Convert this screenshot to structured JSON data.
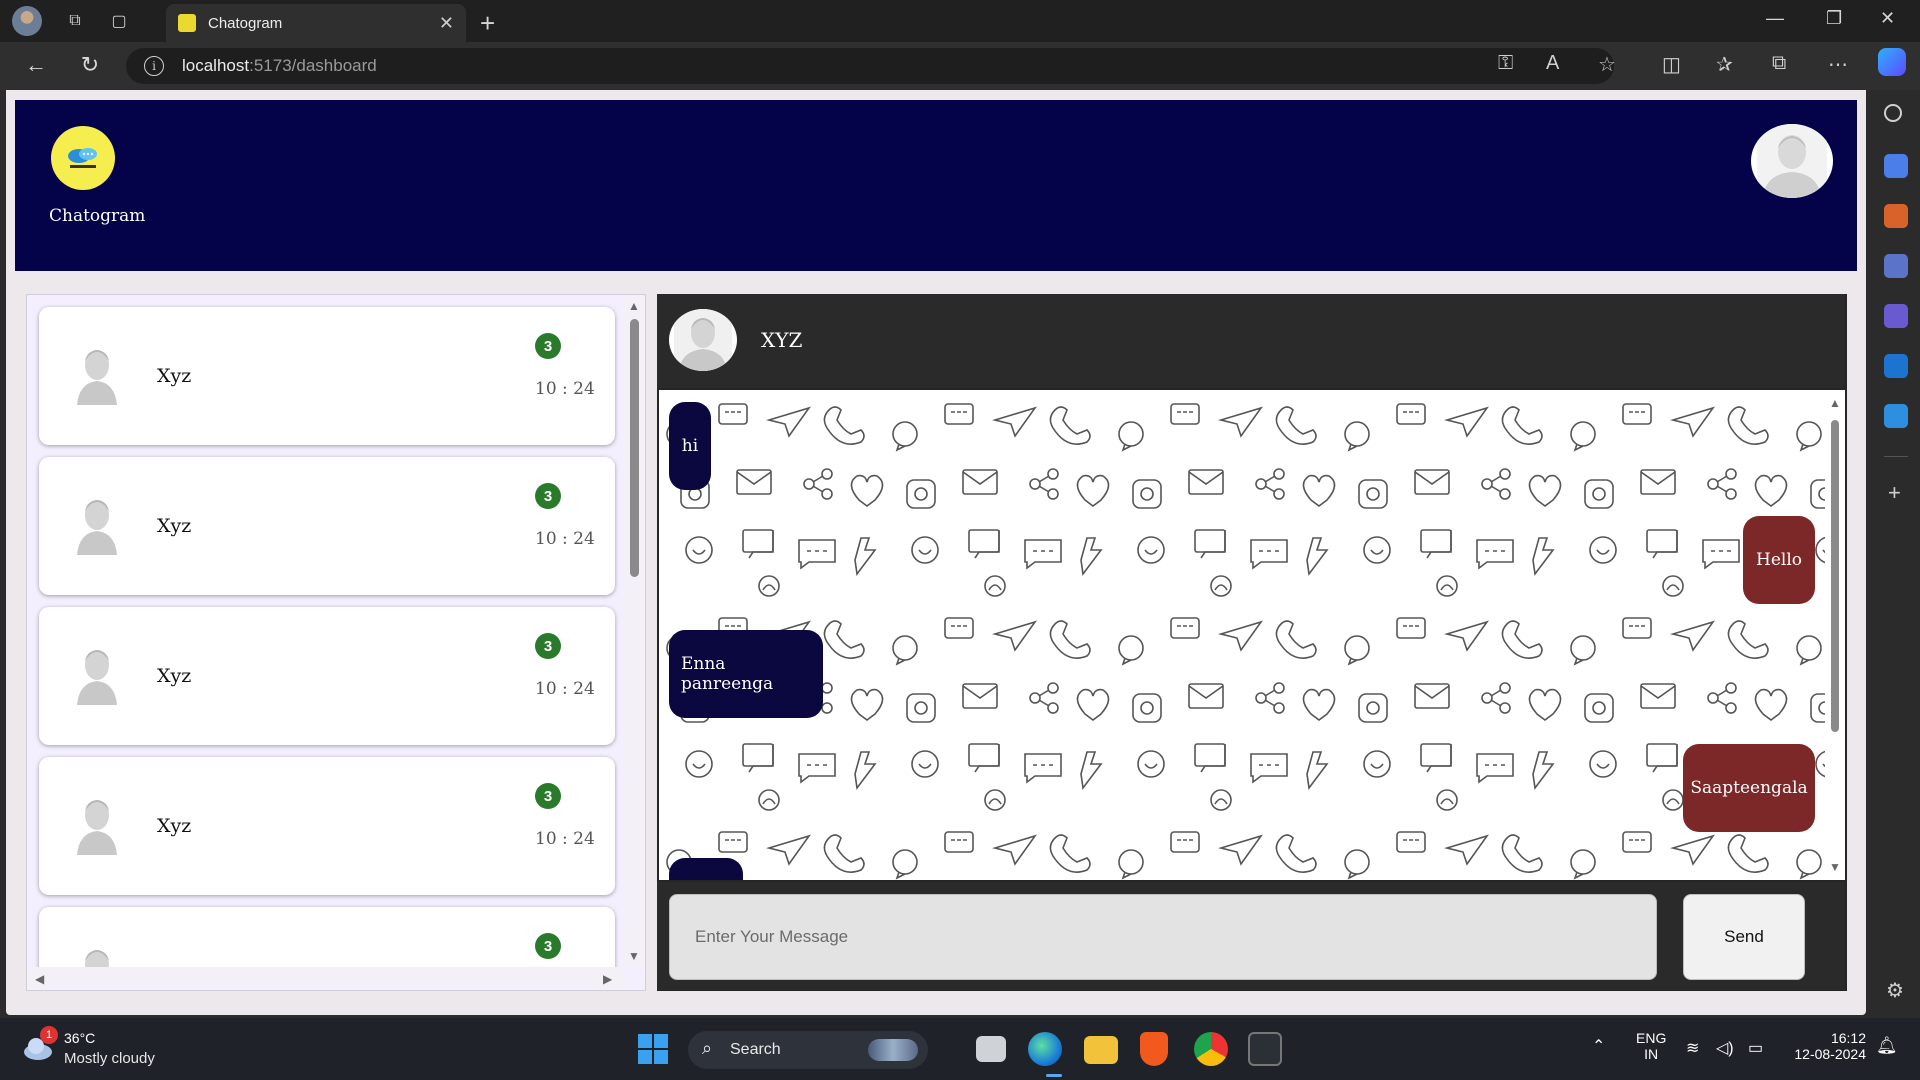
{
  "browser": {
    "tab_title": "Chatogram",
    "url_host": "localhost",
    "url_path": ":5173/dashboard"
  },
  "app": {
    "brand_name": "Chatogram",
    "colors": {
      "header": "#040349",
      "incoming_bubble": "#0b073f",
      "outgoing_bubble": "#7d2828",
      "badge": "#2a7a2c"
    }
  },
  "chat_list": [
    {
      "name": "Xyz",
      "unread": "3",
      "time": "10 : 24"
    },
    {
      "name": "Xyz",
      "unread": "3",
      "time": "10 : 24"
    },
    {
      "name": "Xyz",
      "unread": "3",
      "time": "10 : 24"
    },
    {
      "name": "Xyz",
      "unread": "3",
      "time": "10 : 24"
    },
    {
      "name": "",
      "unread": "3",
      "time": ""
    }
  ],
  "conversation": {
    "contact_name": "XYZ",
    "messages": [
      {
        "text": "hi",
        "direction": "incoming"
      },
      {
        "text": "Hello",
        "direction": "outgoing"
      },
      {
        "text": "Enna panreenga",
        "direction": "incoming"
      },
      {
        "text": "Saapteengala",
        "direction": "outgoing"
      },
      {
        "text": "",
        "direction": "incoming"
      }
    ]
  },
  "composer": {
    "placeholder": "Enter Your Message",
    "send_label": "Send"
  },
  "taskbar": {
    "weather_alert": "1",
    "temperature": "36°C",
    "condition": "Mostly cloudy",
    "search_label": "Search",
    "lang_line1": "ENG",
    "lang_line2": "IN",
    "time": "16:12",
    "date": "12-08-2024"
  }
}
